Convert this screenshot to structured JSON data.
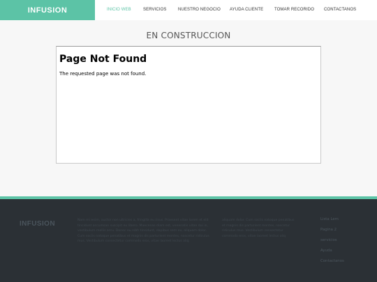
{
  "header": {
    "brand": "INFUSION",
    "nav": [
      "INICIO WEB",
      "SERVICIOS",
      "NUESTRO NEGOCIO",
      "AYUDA CLIENTE",
      "TOMAR RECORIDO",
      "CONTACTANOS"
    ]
  },
  "main": {
    "heading": "EN CONSTRUCCION",
    "frame": {
      "title": "Page Not Found",
      "message": "The requested page was not found."
    }
  },
  "footer": {
    "brand": "INFUSION",
    "col1": "Nam mi enim, auctor non ultricies a, fringilla eu risus. Praesent vitae lorem et elit tincidunt accumsan suscipit eu libero. Maecenas diam est, venenatis vitae dui in, vestibulum mollis arcu. Donec eu nibh tincidunt, dapibus sem eu, aliquam dolor. Cum sociis natoque penatibus et magnis dis parturient montes, nascetur ridiculus mus. Vestibulum consectetur commodo eros, vitae laoreet lectus aliq.",
    "col2": "aliquam dolor. Cum sociis natoque penatibus et magnis dis parturient montes, nascetur ridiculus mus. Vestibulum consectetur commodo eros, vitae laoreet lectus aliq",
    "links": [
      "Lista Lem",
      "Pagina 2",
      "servicios",
      "Ayuda",
      "Contactanos"
    ]
  }
}
